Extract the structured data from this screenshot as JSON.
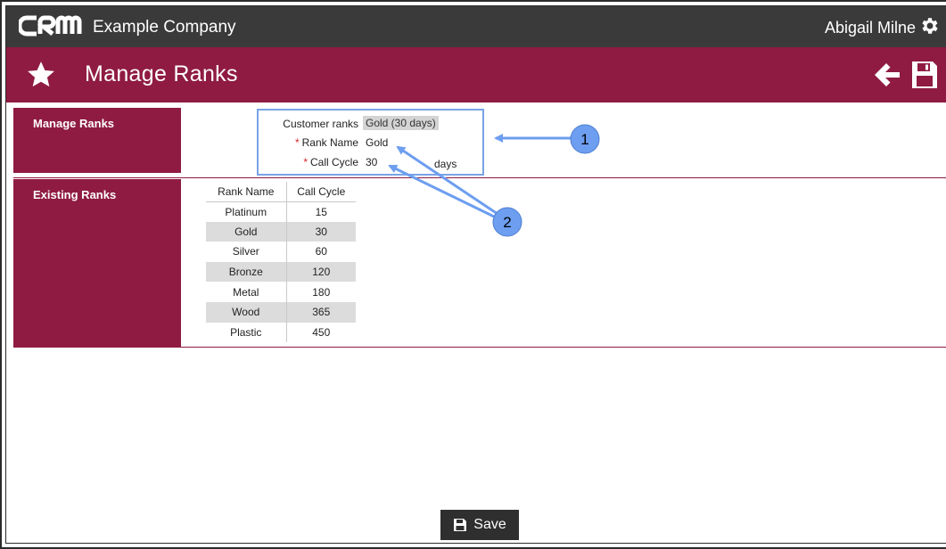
{
  "header": {
    "logo_text": "CRM",
    "company": "Example Company",
    "user": "Abigail Milne"
  },
  "title_bar": {
    "title": "Manage Ranks"
  },
  "sections": {
    "manage_label": "Manage Ranks",
    "existing_label": "Existing Ranks"
  },
  "form": {
    "customer_ranks_label": "Customer ranks",
    "customer_ranks_value": "Gold (30 days)",
    "required_mark": "*",
    "rank_name_label": "Rank Name",
    "rank_name_value": "Gold",
    "call_cycle_label": "Call Cycle",
    "call_cycle_value": "30",
    "call_cycle_unit": "days"
  },
  "table": {
    "headers": [
      "Rank Name",
      "Call Cycle"
    ],
    "rows": [
      [
        "Platinum",
        "15"
      ],
      [
        "Gold",
        "30"
      ],
      [
        "Silver",
        "60"
      ],
      [
        "Bronze",
        "120"
      ],
      [
        "Metal",
        "180"
      ],
      [
        "Wood",
        "365"
      ],
      [
        "Plastic",
        "450"
      ]
    ]
  },
  "callouts": [
    "1",
    "2"
  ],
  "footer": {
    "save_label": "Save"
  },
  "colors": {
    "brand": "#8f1b43",
    "topbar": "#3a3a3a",
    "callout": "#6d9ef0",
    "callout_border": "#7aa3e6"
  },
  "icons": [
    "crm-logo",
    "gear-icon",
    "star-icon",
    "back-arrow-icon",
    "save-icon"
  ]
}
